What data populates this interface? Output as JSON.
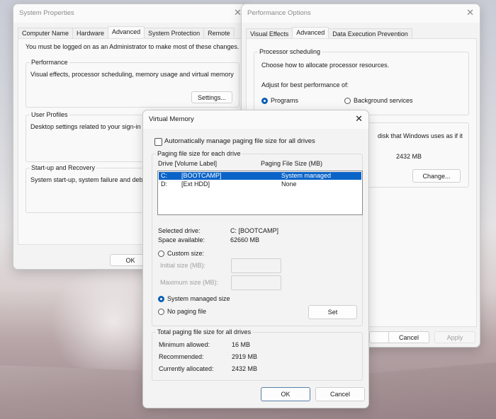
{
  "system_properties": {
    "title": "System Properties",
    "tabs": [
      {
        "label": "Computer Name"
      },
      {
        "label": "Hardware"
      },
      {
        "label": "Advanced"
      },
      {
        "label": "System Protection"
      },
      {
        "label": "Remote"
      }
    ],
    "selected_tab": "Advanced",
    "admin_notice": "You must be logged on as an Administrator to make most of these changes.",
    "performance": {
      "label": "Performance",
      "description": "Visual effects, processor scheduling, memory usage and virtual memory",
      "settings_button": "Settings..."
    },
    "user_profiles": {
      "label": "User Profiles",
      "description": "Desktop settings related to your sign-in"
    },
    "startup_recovery": {
      "label": "Start-up and Recovery",
      "description": "System start-up, system failure and debug"
    },
    "ok_button": "OK"
  },
  "performance_options": {
    "title": "Performance Options",
    "tabs": [
      {
        "label": "Visual Effects"
      },
      {
        "label": "Advanced"
      },
      {
        "label": "Data Execution Prevention"
      }
    ],
    "selected_tab": "Advanced",
    "processor_scheduling": {
      "label": "Processor scheduling",
      "description": "Choose how to allocate processor resources.",
      "adjust_label": "Adjust for best performance of:",
      "options": [
        {
          "label": "Programs",
          "selected": true
        },
        {
          "label": "Background services",
          "selected": false
        }
      ]
    },
    "virtual_memory": {
      "description_fragment": "disk that Windows uses as if it",
      "total_size": "2432 MB",
      "change_button": "Change..."
    },
    "cancel_button": "Cancel",
    "apply_button": "Apply"
  },
  "virtual_memory_dialog": {
    "title": "Virtual Memory",
    "auto_manage_label": "Automatically manage paging file size for all drives",
    "auto_manage_checked": false,
    "per_drive_group_label": "Paging file size for each drive",
    "columns": {
      "drive": "Drive  [Volume Label]",
      "size": "Paging File Size (MB)"
    },
    "drives": [
      {
        "drive": "C:",
        "label": "[BOOTCAMP]",
        "size": "System managed",
        "selected": true
      },
      {
        "drive": "D:",
        "label": "[Ext HDD]",
        "size": "None",
        "selected": false
      }
    ],
    "selected_drive_label": "Selected drive:",
    "selected_drive_value": "C:  [BOOTCAMP]",
    "space_available_label": "Space available:",
    "space_available_value": "62660 MB",
    "custom_size_label": "Custom size:",
    "initial_size_label": "Initial size (MB):",
    "initial_size_value": "",
    "maximum_size_label": "Maximum size (MB):",
    "maximum_size_value": "",
    "system_managed_label": "System managed size",
    "no_paging_label": "No paging file",
    "selected_option": "System managed size",
    "set_button": "Set",
    "totals_group_label": "Total paging file size for all drives",
    "minimum_allowed_label": "Minimum allowed:",
    "minimum_allowed_value": "16 MB",
    "recommended_label": "Recommended:",
    "recommended_value": "2919 MB",
    "currently_allocated_label": "Currently allocated:",
    "currently_allocated_value": "2432 MB",
    "ok_button": "OK",
    "cancel_button": "Cancel"
  }
}
